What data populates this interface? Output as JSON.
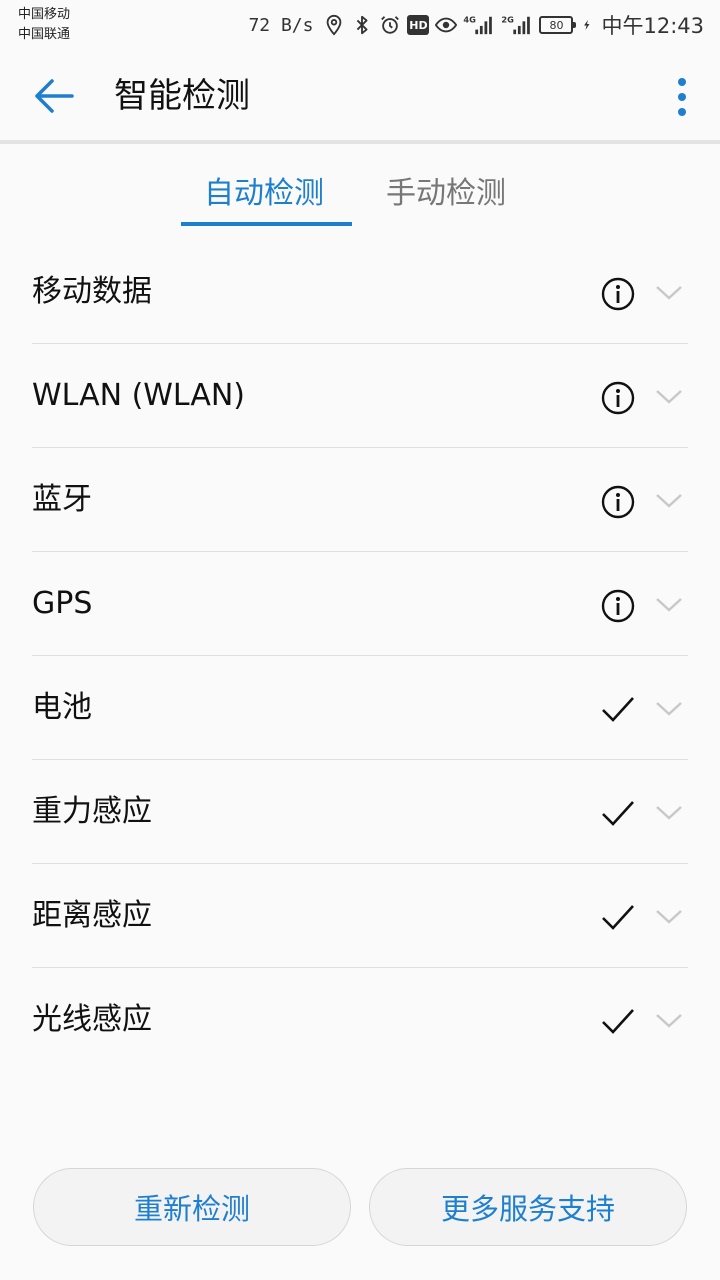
{
  "status_bar": {
    "carrier_1": "中国移动",
    "carrier_2": "中国联通",
    "net_speed": "72 B/s",
    "hd_label": "HD",
    "net_4g": "4G",
    "net_2g": "2G",
    "battery_level": "80",
    "time": "中午12:43"
  },
  "header": {
    "title": "智能检测",
    "back_icon": "arrow-left-icon",
    "more_icon": "more-vertical-icon"
  },
  "tabs": [
    {
      "label": "自动检测",
      "active": true
    },
    {
      "label": "手动检测",
      "active": false
    }
  ],
  "items": [
    {
      "label": "移动数据",
      "status": "info"
    },
    {
      "label": "WLAN (WLAN)",
      "status": "info"
    },
    {
      "label": "蓝牙",
      "status": "info"
    },
    {
      "label": "GPS",
      "status": "info"
    },
    {
      "label": "电池",
      "status": "ok"
    },
    {
      "label": "重力感应",
      "status": "ok"
    },
    {
      "label": "距离感应",
      "status": "ok"
    },
    {
      "label": "光线感应",
      "status": "ok"
    }
  ],
  "buttons": {
    "recheck": "重新检测",
    "more_support": "更多服务支持"
  },
  "colors": {
    "accent": "#1f7fcf",
    "inactive_tab": "#777777",
    "divider": "#e0e0e0",
    "chevron": "#c8c8c8"
  }
}
